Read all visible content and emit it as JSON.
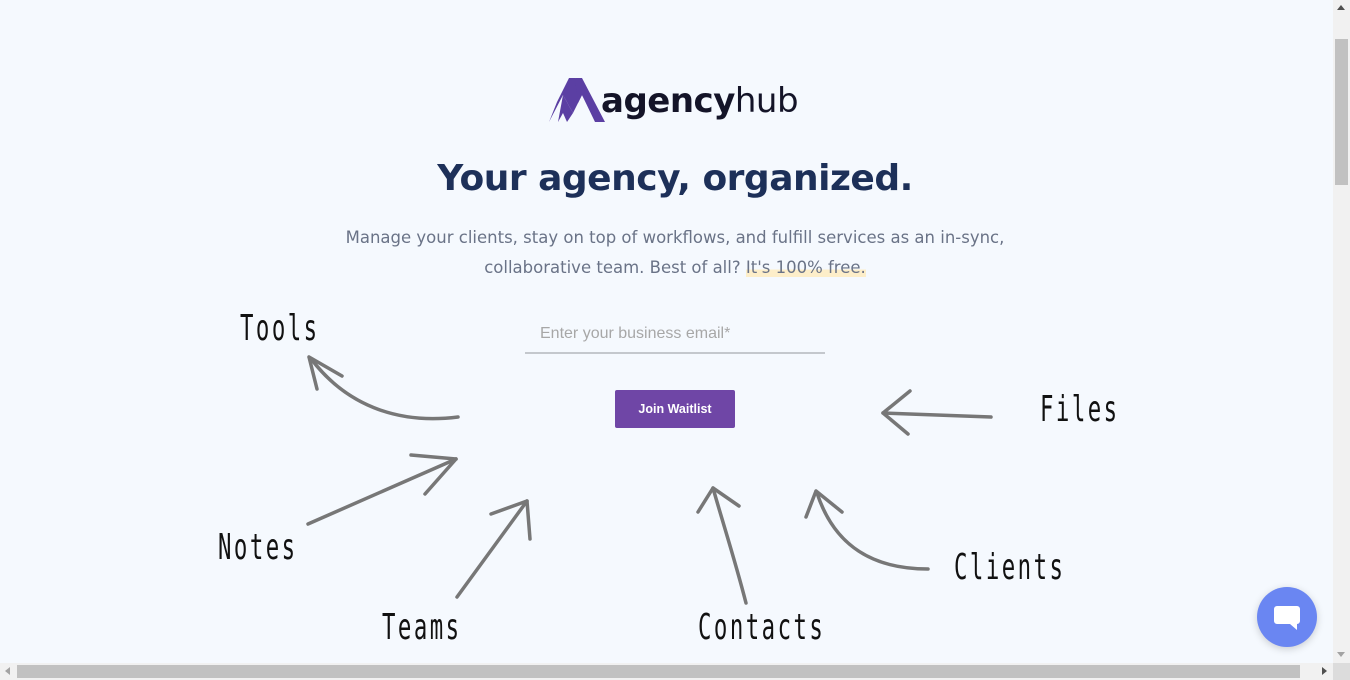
{
  "brand": {
    "name_bold": "agency",
    "name_light": "hub",
    "mark_color": "#5b3fa3"
  },
  "hero": {
    "headline": "Your agency, organized.",
    "subtitle_main": "Manage your clients, stay on top of workflows, and fulfill services as an in-sync, collaborative team. Best of all? ",
    "subtitle_highlight": "It's 100% free."
  },
  "form": {
    "email_placeholder": "Enter your business email*",
    "email_value": "",
    "submit_label": "Join Waitlist",
    "submit_color": "#6f46a6"
  },
  "annotations": {
    "tools": "Tools",
    "notes": "Notes",
    "teams": "Teams",
    "contacts": "Contacts",
    "clients": "Clients",
    "files": "Files"
  },
  "chat": {
    "icon": "chat-bubble-icon",
    "color": "#6a86f2"
  }
}
